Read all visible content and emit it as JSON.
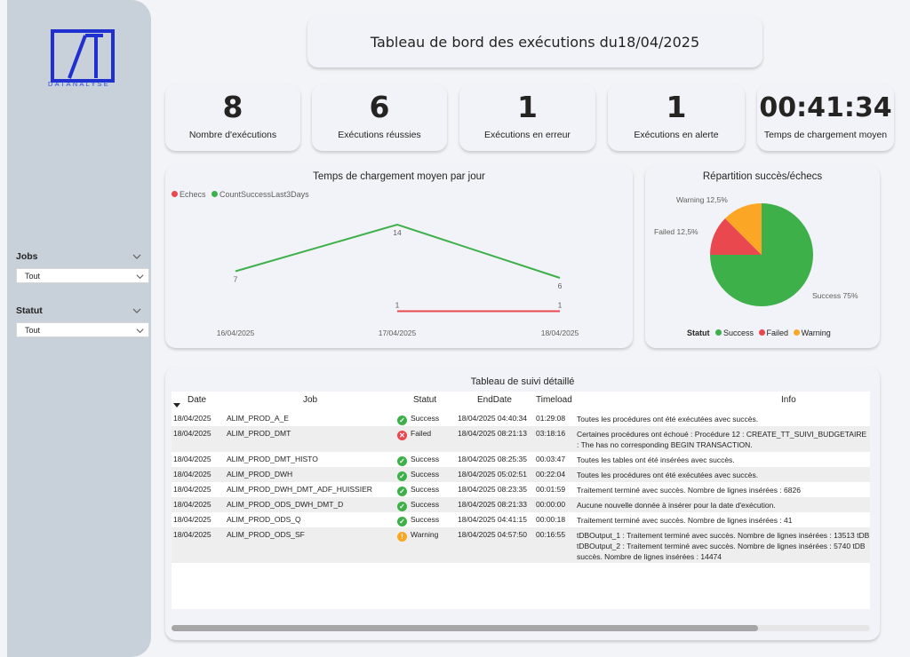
{
  "brand": {
    "logo_text": "DATANALYSE",
    "logo_letter": "A"
  },
  "title": "Tableau de bord des exécutions du18/04/2025",
  "filters": [
    {
      "label": "Jobs",
      "value": "Tout"
    },
    {
      "label": "Statut",
      "value": "Tout"
    }
  ],
  "kpis": [
    {
      "value": "8",
      "label": "Nombre d'exécutions"
    },
    {
      "value": "6",
      "label": "Exécutions réussies"
    },
    {
      "value": "1",
      "label": "Exécutions en erreur"
    },
    {
      "value": "1",
      "label": "Exécutions en alerte"
    },
    {
      "value": "00:41:34",
      "label": "Temps de chargement moyen"
    }
  ],
  "colors": {
    "success": "#3eb049",
    "failed": "#e8484e",
    "warning": "#fca625"
  },
  "chart_data": [
    {
      "type": "line",
      "title": "Temps de chargement moyen par jour",
      "categories": [
        "16/04/2025",
        "17/04/2025",
        "18/04/2025"
      ],
      "series": [
        {
          "name": "Echecs",
          "color": "#e8484e",
          "values": [
            null,
            1,
            1
          ]
        },
        {
          "name": "CountSuccessLast3Days",
          "color": "#3eb049",
          "values": [
            7,
            14,
            6
          ]
        }
      ],
      "ylim": [
        0,
        16
      ]
    },
    {
      "type": "pie",
      "title": "Répartition succès/échecs",
      "legend_title": "Statut",
      "slices": [
        {
          "name": "Success",
          "value": 75,
          "label": "Success 75%",
          "color": "#3eb049"
        },
        {
          "name": "Failed",
          "value": 12.5,
          "label": "Failed 12,5%",
          "color": "#e8484e"
        },
        {
          "name": "Warning",
          "value": 12.5,
          "label": "Warning 12,5%",
          "color": "#fca625"
        }
      ]
    }
  ],
  "table": {
    "title": "Tableau de suivi détaillé",
    "columns": [
      "Date",
      "Job",
      "Statut",
      "EndDate",
      "Timeload",
      "Info"
    ],
    "rows": [
      {
        "date": "18/04/2025",
        "job": "ALIM_PROD_A_E",
        "status": "Success",
        "end": "18/04/2025 04:40:34",
        "time": "01:29:08",
        "info": "Toutes les procédures ont été exécutées avec succès."
      },
      {
        "date": "18/04/2025",
        "job": "ALIM_PROD_DMT",
        "status": "Failed",
        "end": "18/04/2025 08:21:13",
        "time": "03:18:16",
        "info": "Certaines procédures ont échoué : Procédure 12 : CREATE_TT_SUIVI_BUDGETAIRE : The has no corresponding BEGIN TRANSACTION."
      },
      {
        "date": "18/04/2025",
        "job": "ALIM_PROD_DMT_HISTO",
        "status": "Success",
        "end": "18/04/2025 08:25:35",
        "time": "00:03:47",
        "info": "Toutes les tables ont été insérées avec succès."
      },
      {
        "date": "18/04/2025",
        "job": "ALIM_PROD_DWH",
        "status": "Success",
        "end": "18/04/2025 05:02:51",
        "time": "00:22:04",
        "info": "Toutes les procédures ont été exécutées avec succès."
      },
      {
        "date": "18/04/2025",
        "job": "ALIM_PROD_DWH_DMT_ADF_HUISSIER",
        "status": "Success",
        "end": "18/04/2025 08:23:35",
        "time": "00:01:59",
        "info": "Traitement terminé avec succès. Nombre de lignes insérées : 6826"
      },
      {
        "date": "18/04/2025",
        "job": "ALIM_PROD_ODS_DWH_DMT_D",
        "status": "Success",
        "end": "18/04/2025 08:21:33",
        "time": "00:00:00",
        "info": "Aucune nouvelle donnée à insérer pour la date d'exécution."
      },
      {
        "date": "18/04/2025",
        "job": "ALIM_PROD_ODS_Q",
        "status": "Success",
        "end": "18/04/2025 04:41:15",
        "time": "00:00:18",
        "info": "Traitement terminé avec succès. Nombre de lignes insérées : 41"
      },
      {
        "date": "18/04/2025",
        "job": "ALIM_PROD_ODS_SF",
        "status": "Warning",
        "end": "18/04/2025 04:57:50",
        "time": "00:16:55",
        "info": "tDBOutput_1 : Traitement terminé avec succès. Nombre de lignes insérées : 13513 tDB tDBOutput_2 : Traitement terminé avec succès. Nombre de lignes insérées : 5740 tDB succès. Nombre de lignes insérées : 14474"
      }
    ]
  }
}
